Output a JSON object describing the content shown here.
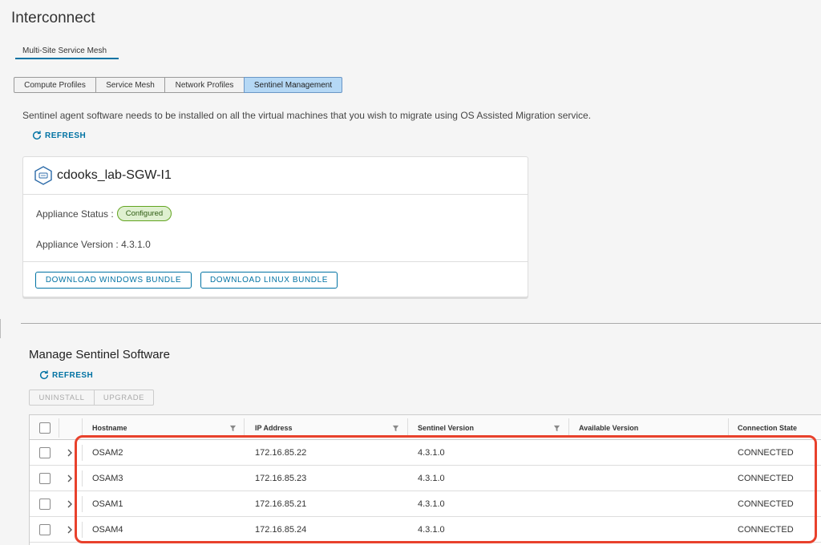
{
  "page": {
    "title": "Interconnect"
  },
  "top_tab": {
    "label": "Multi-Site Service Mesh"
  },
  "sub_tabs": [
    {
      "label": "Compute Profiles",
      "active": false
    },
    {
      "label": "Service Mesh",
      "active": false
    },
    {
      "label": "Network Profiles",
      "active": false
    },
    {
      "label": "Sentinel Management",
      "active": true
    }
  ],
  "info_text": "Sentinel agent software needs to be installed on all the virtual machines that you wish to migrate using OS Assisted Migration service.",
  "refresh_label": "REFRESH",
  "appliance": {
    "name": "cdooks_lab-SGW-I1",
    "status_label": "Appliance Status :",
    "status": "Configured",
    "version_text": "Appliance Version : 4.3.1.0",
    "download_windows": "DOWNLOAD WINDOWS BUNDLE",
    "download_linux": "DOWNLOAD LINUX BUNDLE"
  },
  "manage": {
    "title": "Manage Sentinel Software",
    "refresh_label": "REFRESH",
    "uninstall_label": "UNINSTALL",
    "upgrade_label": "UPGRADE"
  },
  "table": {
    "columns": [
      "Hostname",
      "IP Address",
      "Sentinel Version",
      "Available Version",
      "Connection State"
    ],
    "rows": [
      {
        "hostname": "OSAM2",
        "ip": "172.16.85.22",
        "version": "4.3.1.0",
        "available": "",
        "state": "CONNECTED"
      },
      {
        "hostname": "OSAM3",
        "ip": "172.16.85.23",
        "version": "4.3.1.0",
        "available": "",
        "state": "CONNECTED"
      },
      {
        "hostname": "OSAM1",
        "ip": "172.16.85.21",
        "version": "4.3.1.0",
        "available": "",
        "state": "CONNECTED"
      },
      {
        "hostname": "OSAM4",
        "ip": "172.16.85.24",
        "version": "4.3.1.0",
        "available": "",
        "state": "CONNECTED"
      }
    ]
  },
  "colors": {
    "accent": "#0072a3",
    "active_tab": "#b5d8f5",
    "status_green": "#62a420",
    "highlight": "#e8412c"
  }
}
